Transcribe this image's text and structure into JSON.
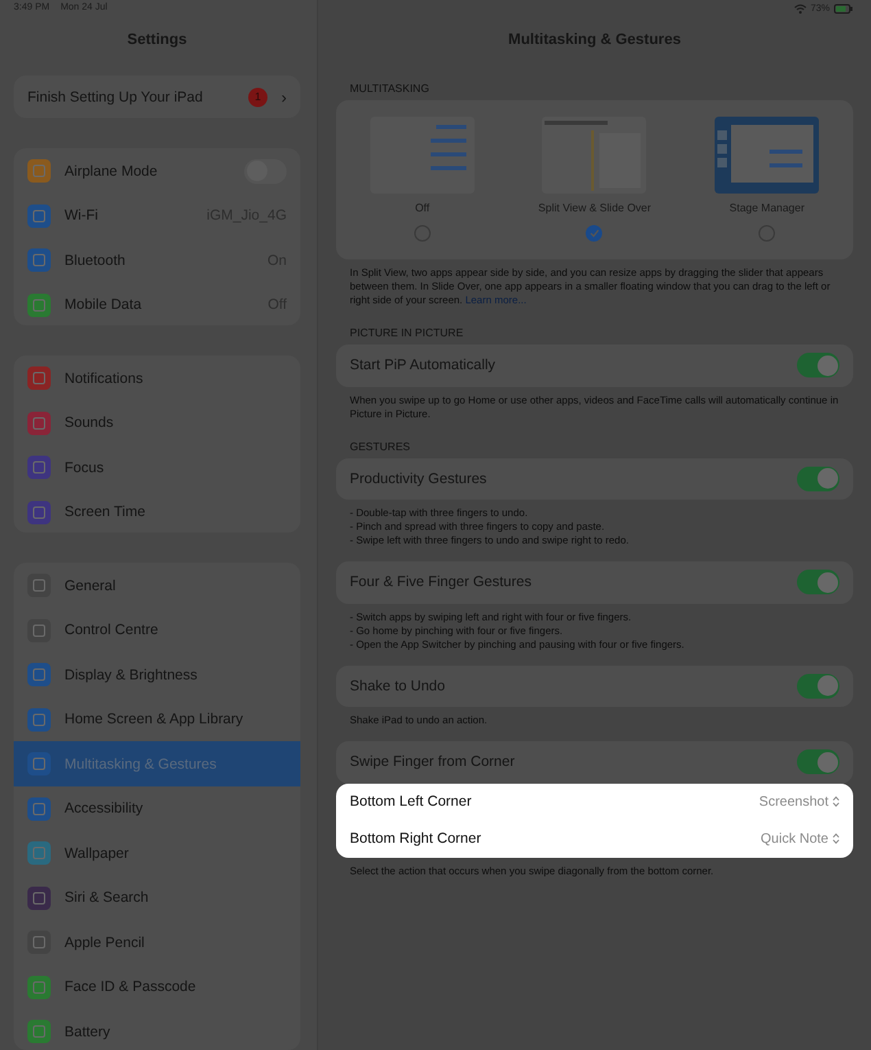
{
  "status_bar": {
    "time": "3:49 PM",
    "date": "Mon 24 Jul",
    "battery": "73%"
  },
  "sidebar": {
    "title": "Settings",
    "setup": {
      "label": "Finish Setting Up Your iPad",
      "badge": "1",
      "chevron": "›"
    },
    "groups": [
      {
        "items": [
          {
            "label": "Airplane Mode",
            "kind": "toggle",
            "on": false,
            "color": "#8a5a1e",
            "selected": false
          },
          {
            "label": "Wi-Fi",
            "kind": "value",
            "value": "iGM_Jio_4G",
            "color": "#1e4e8a",
            "selected": false
          },
          {
            "label": "Bluetooth",
            "kind": "value",
            "value": "On",
            "color": "#1e4e8a",
            "selected": false
          },
          {
            "label": "Mobile Data",
            "kind": "value",
            "value": "Off",
            "color": "#2a7a32",
            "selected": false
          }
        ]
      },
      {
        "items": [
          {
            "label": "Notifications",
            "kind": "plain",
            "color": "#8a2424",
            "selected": false
          },
          {
            "label": "Sounds",
            "kind": "plain",
            "color": "#8a2438",
            "selected": false
          },
          {
            "label": "Focus",
            "kind": "plain",
            "color": "#3e3480",
            "selected": false
          },
          {
            "label": "Screen Time",
            "kind": "plain",
            "color": "#3e3480",
            "selected": false
          }
        ]
      },
      {
        "items": [
          {
            "label": "General",
            "kind": "plain",
            "color": "#444444",
            "selected": false
          },
          {
            "label": "Control Centre",
            "kind": "plain",
            "color": "#444444",
            "selected": false
          },
          {
            "label": "Display & Brightness",
            "kind": "plain",
            "color": "#1e4e8a",
            "selected": false
          },
          {
            "label": "Home Screen & App Library",
            "kind": "plain",
            "color": "#1e4e8a",
            "selected": false
          },
          {
            "label": "Multitasking & Gestures",
            "kind": "plain",
            "color": "#1e4e8a",
            "selected": true
          },
          {
            "label": "Accessibility",
            "kind": "plain",
            "color": "#1e4e8a",
            "selected": false
          },
          {
            "label": "Wallpaper",
            "kind": "plain",
            "color": "#2a6a80",
            "selected": false
          },
          {
            "label": "Siri & Search",
            "kind": "plain",
            "color": "#3a2a4a",
            "selected": false
          },
          {
            "label": "Apple Pencil",
            "kind": "plain",
            "color": "#444444",
            "selected": false
          },
          {
            "label": "Face ID & Passcode",
            "kind": "plain",
            "color": "#2a7a32",
            "selected": false
          },
          {
            "label": "Battery",
            "kind": "plain",
            "color": "#2a7a32",
            "selected": false
          }
        ]
      }
    ]
  },
  "detail": {
    "title": "Multitasking & Gestures",
    "multitasking": {
      "header": "MULTITASKING",
      "options": [
        {
          "label": "Off",
          "kind": "off",
          "selected": false
        },
        {
          "label": "Split View & Slide Over",
          "kind": "split",
          "selected": true
        },
        {
          "label": "Stage Manager",
          "kind": "stage",
          "selected": false
        }
      ],
      "footer": "In Split View, two apps appear side by side, and you can resize apps by dragging the slider that appears between them. In Slide Over, one app appears in a smaller floating window that you can drag to the left or right side of your screen.",
      "link": "Learn more..."
    },
    "sections": [
      {
        "header": "PICTURE IN PICTURE",
        "groups": [
          {
            "highlighted": false,
            "rows": [
              {
                "label": "Start PiP Automatically",
                "kind": "toggle",
                "on": true
              }
            ],
            "footer": [
              "When you swipe up to go Home or use other apps, videos and FaceTime calls will automatically continue in Picture in Picture."
            ]
          }
        ]
      },
      {
        "header": "GESTURES",
        "groups": [
          {
            "highlighted": false,
            "rows": [
              {
                "label": "Productivity Gestures",
                "kind": "toggle",
                "on": true
              }
            ],
            "footer": [
              "- Double-tap with three fingers to undo.",
              "- Pinch and spread with three fingers to copy and paste.",
              "- Swipe left with three fingers to undo and swipe right to redo."
            ]
          },
          {
            "highlighted": false,
            "rows": [
              {
                "label": "Four & Five Finger Gestures",
                "kind": "toggle",
                "on": true
              }
            ],
            "footer": [
              "- Switch apps by swiping left and right with four or five fingers.",
              "- Go home by pinching with four or five fingers.",
              "- Open the App Switcher by pinching and pausing with four or five fingers."
            ]
          },
          {
            "highlighted": false,
            "rows": [
              {
                "label": "Shake to Undo",
                "kind": "toggle",
                "on": true
              }
            ],
            "footer": [
              "Shake iPad to undo an action."
            ]
          },
          {
            "highlighted": false,
            "rows": [
              {
                "label": "Swipe Finger from Corner",
                "kind": "toggle",
                "on": true
              }
            ]
          },
          {
            "highlighted": true,
            "rows": [
              {
                "label": "Bottom Left Corner",
                "kind": "picker",
                "value": "Screenshot"
              },
              {
                "label": "Bottom Right Corner",
                "kind": "picker",
                "value": "Quick Note"
              }
            ],
            "footer": [
              "Select the action that occurs when you swipe diagonally from the bottom corner."
            ]
          }
        ]
      }
    ]
  }
}
